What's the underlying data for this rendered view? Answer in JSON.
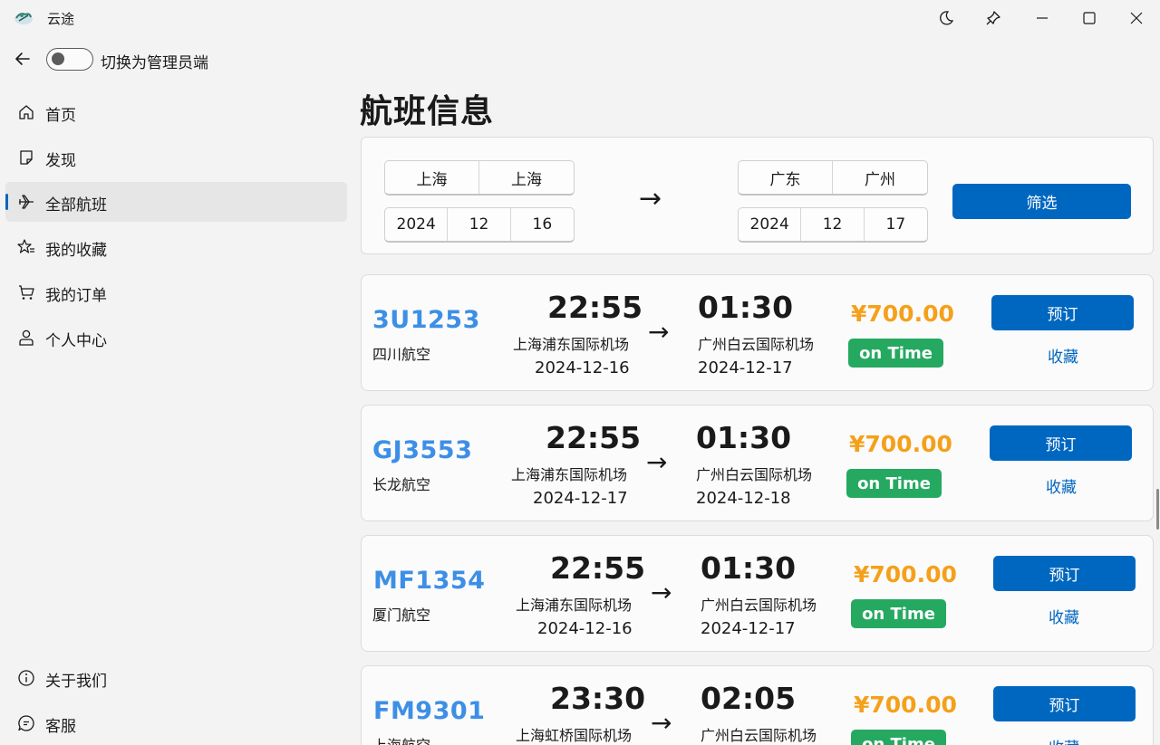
{
  "app": {
    "title": "云途"
  },
  "top": {
    "toggle_label": "切换为管理员端"
  },
  "sidebar": {
    "items": [
      {
        "label": "首页",
        "icon": "home-icon"
      },
      {
        "label": "发现",
        "icon": "note-icon"
      },
      {
        "label": "全部航班",
        "icon": "airplane-icon",
        "active": true
      },
      {
        "label": "我的收藏",
        "icon": "star-list-icon"
      },
      {
        "label": "我的订单",
        "icon": "cart-icon"
      },
      {
        "label": "个人中心",
        "icon": "person-icon"
      }
    ],
    "footer": [
      {
        "label": "关于我们",
        "icon": "info-icon"
      },
      {
        "label": "客服",
        "icon": "chat-icon"
      }
    ]
  },
  "main": {
    "title": "航班信息",
    "filter": {
      "from_province": "上海",
      "from_city": "上海",
      "from_year": "2024",
      "from_month": "12",
      "from_day": "16",
      "arrow": "→",
      "to_province": "广东",
      "to_city": "广州",
      "to_year": "2024",
      "to_month": "12",
      "to_day": "17",
      "button": "筛选"
    },
    "flights": [
      {
        "code": "3U1253",
        "airline": "四川航空",
        "dep_time": "22:55",
        "dep_airport": "上海浦东国际机场",
        "dep_date": "2024-12-16",
        "arr_time": "01:30",
        "arr_airport": "广州白云国际机场",
        "arr_date": "2024-12-17",
        "price": "¥700.00",
        "status": "on Time",
        "book": "预订",
        "fav": "收藏",
        "arrow": "→"
      },
      {
        "code": "GJ3553",
        "airline": "长龙航空",
        "dep_time": "22:55",
        "dep_airport": "上海浦东国际机场",
        "dep_date": "2024-12-17",
        "arr_time": "01:30",
        "arr_airport": "广州白云国际机场",
        "arr_date": "2024-12-18",
        "price": "¥700.00",
        "status": "on Time",
        "book": "预订",
        "fav": "收藏",
        "arrow": "→"
      },
      {
        "code": "MF1354",
        "airline": "厦门航空",
        "dep_time": "22:55",
        "dep_airport": "上海浦东国际机场",
        "dep_date": "2024-12-16",
        "arr_time": "01:30",
        "arr_airport": "广州白云国际机场",
        "arr_date": "2024-12-17",
        "price": "¥700.00",
        "status": "on Time",
        "book": "预订",
        "fav": "收藏",
        "arrow": "→"
      },
      {
        "code": "FM9301",
        "airline": "上海航空",
        "dep_time": "23:30",
        "dep_airport": "上海虹桥国际机场",
        "dep_date": "",
        "arr_time": "02:05",
        "arr_airport": "广州白云国际机场",
        "arr_date": "",
        "price": "¥700.00",
        "status": "on Time",
        "book": "预订",
        "fav": "收藏",
        "arrow": "→"
      }
    ]
  },
  "colors": {
    "accent": "#0067c0",
    "flight_code": "#3d8fe6",
    "price": "#f5a01a",
    "status_green": "#25a961"
  }
}
